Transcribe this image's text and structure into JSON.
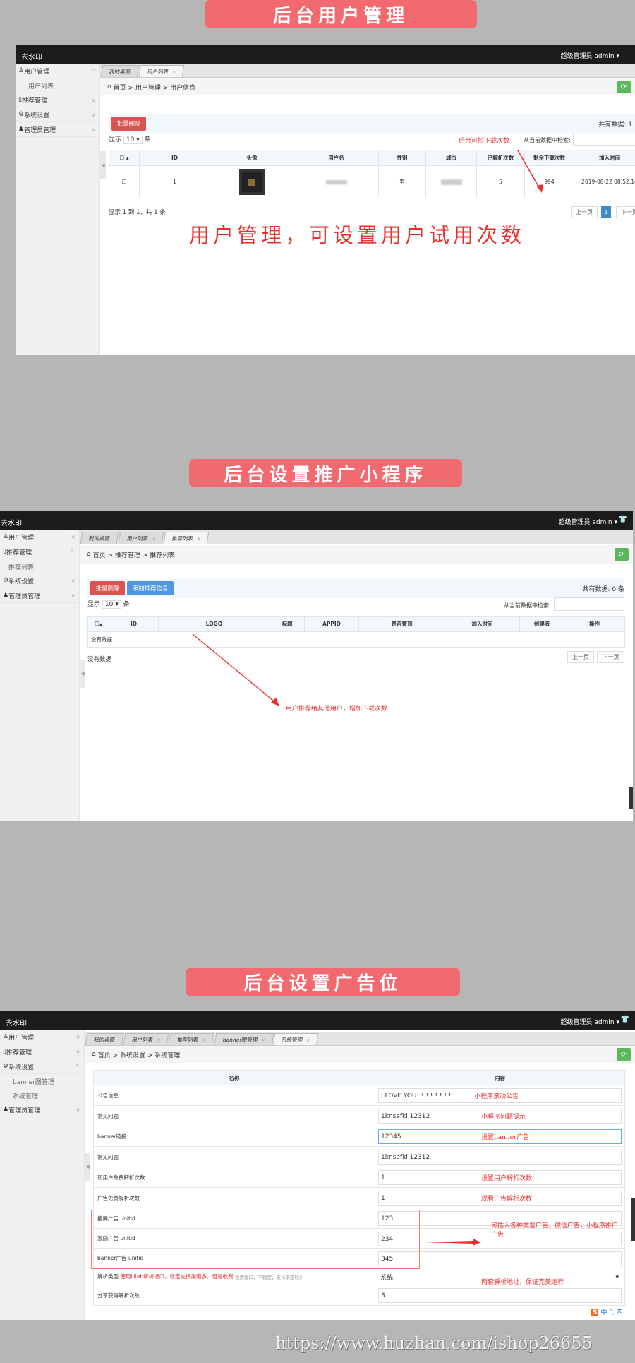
{
  "section1": {
    "banner": "后台用户管理",
    "brand": "去水印",
    "user": "超级管理员",
    "admin": "admin ▾",
    "sidebar": [
      {
        "label": "用户管理",
        "icon": "user-icon",
        "chev": "^",
        "sub": [
          "用户列表"
        ]
      },
      {
        "label": "推荐管理",
        "icon": "clipboard-icon",
        "chev": "v"
      },
      {
        "label": "系统设置",
        "icon": "gear-icon",
        "chev": "v"
      },
      {
        "label": "管理员管理",
        "icon": "admin-icon",
        "chev": "v"
      }
    ],
    "tabs": [
      {
        "label": "我的桌面"
      },
      {
        "label": "用户列表",
        "close": "x"
      }
    ],
    "breadcrumb": "首页 > 用户管理 > 用户信息",
    "batch_delete": "批量删除",
    "total": "共有数据: 1",
    "show_prefix": "显示",
    "page_size": "10 ▾",
    "show_suffix": "条",
    "search_label": "从当前数据中检索:",
    "columns": [
      "",
      "ID",
      "头像",
      "用户名",
      "性别",
      "城市",
      "已解析次数",
      "剩余下载次数",
      "加入时间"
    ],
    "rows": [
      {
        "id": "1",
        "gender": "男",
        "parsed": "5",
        "remaining": "994",
        "joined": "2019-08-22 08:52:14"
      }
    ],
    "footer": "显示 1 到 1，共 1 条",
    "prev": "上一页",
    "page": "1",
    "next": "下一页",
    "note": "后台可控下载次数",
    "caption": "用户管理，可设置用户试用次数"
  },
  "section2": {
    "banner": "后台设置推广小程序",
    "brand": "去水印",
    "user": "超级管理员",
    "admin": "admin ▾",
    "sidebar": [
      {
        "label": "用户管理",
        "chev": "v"
      },
      {
        "label": "推荐管理",
        "chev": "^",
        "sub": [
          "推荐列表"
        ]
      },
      {
        "label": "系统设置",
        "chev": "v"
      },
      {
        "label": "管理员管理",
        "chev": "v"
      }
    ],
    "tabs": [
      {
        "label": "我的桌面"
      },
      {
        "label": "用户列表",
        "close": "x"
      },
      {
        "label": "推荐列表",
        "close": "x"
      }
    ],
    "breadcrumb": "首页 > 推荐管理 > 推荐列表",
    "batch_delete": "批量删除",
    "add": "添加推荐信息",
    "total": "共有数据: 0 条",
    "show_prefix": "显示",
    "page_size": "10 ▾",
    "show_suffix": "条",
    "search_label": "从当前数据中检索:",
    "columns": [
      "",
      "ID",
      "LOGO",
      "标题",
      "APPID",
      "是否置顶",
      "加入时间",
      "创建者",
      "操作"
    ],
    "empty": "没有数据",
    "footer": "没有数据",
    "prev": "上一页",
    "next": "下一页",
    "note": "用户推荐给其他用户，增加下载次数"
  },
  "section3": {
    "banner": "后台设置广告位",
    "brand": "去水印",
    "user": "超级管理员",
    "admin": "admin ▾",
    "sidebar": [
      {
        "label": "用户管理",
        "chev": "v"
      },
      {
        "label": "推荐管理",
        "chev": "v"
      },
      {
        "label": "系统设置",
        "chev": "^",
        "sub": [
          "banner图管理",
          "系统管理"
        ]
      },
      {
        "label": "管理员管理",
        "chev": "v"
      }
    ],
    "tabs": [
      {
        "label": "我的桌面"
      },
      {
        "label": "用户列表",
        "close": "x"
      },
      {
        "label": "推荐列表",
        "close": "x"
      },
      {
        "label": "banner图管理",
        "close": "x"
      },
      {
        "label": "系统管理",
        "close": "x"
      }
    ],
    "breadcrumb": "首页 > 系统设置 > 系统管理",
    "columns": [
      "名称",
      "内容"
    ],
    "rows": [
      {
        "name": "公告信息",
        "value": "I LOVE YOU! ! ! ! ! ! ! !",
        "note": "小程序滚动公告"
      },
      {
        "name": "常见问题",
        "value": "1knsafkl 12312",
        "note": "小程序问题提示"
      },
      {
        "name": "banner链接",
        "value": "12345",
        "note": "设置banner广告"
      },
      {
        "name": "常见问题",
        "value": "1knsafkl 12312"
      },
      {
        "name": "新用户免费解析次数",
        "value": "1",
        "note": "设置用户解析次数"
      },
      {
        "name": "广告免费解析次数",
        "value": "1",
        "note": "观看广告解析次数"
      },
      {
        "name": "插屏广告 unitid",
        "value": "123"
      },
      {
        "name": "激励广告 unitid",
        "value": "234"
      },
      {
        "name": "banner广告 unitid",
        "value": "345"
      },
      {
        "name": "解析类型",
        "hint_red": "使用iiilab解析接口，稳定支持渠道多，但是收费",
        "hint_gray": "免费接口，不稳定，支持渠道较少",
        "value": "系统",
        "note": "两套解析地址，保证完美运行"
      },
      {
        "name": "分享获得解析次数",
        "value": "3"
      }
    ],
    "ad_note": "可插入各种类型广告，微信广告，小程序推广广告",
    "ime": "中 °, 四"
  },
  "watermark": "https://www.huzhan.com/ishop26655",
  "colors": {
    "accent_red": "#d9534f",
    "banner": "#f06a70",
    "green": "#5cb85c",
    "blue": "#4f97e0"
  }
}
